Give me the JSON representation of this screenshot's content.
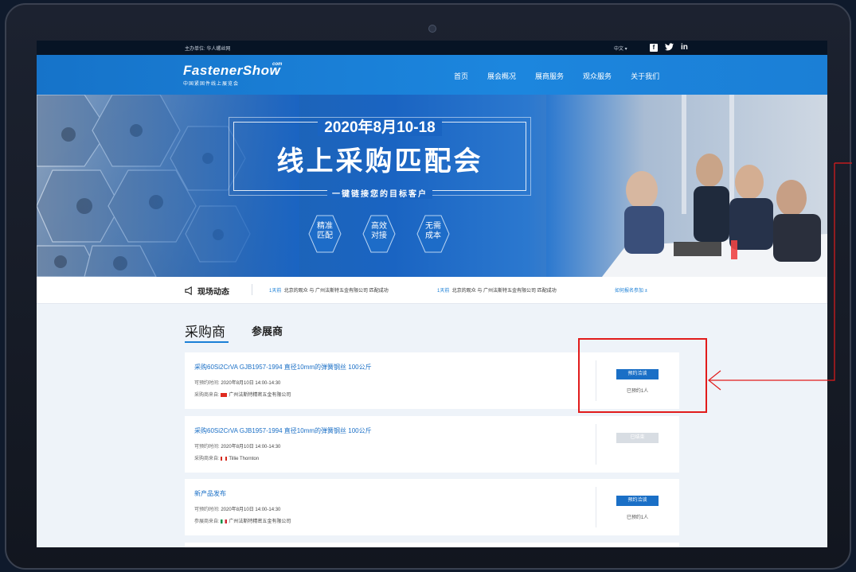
{
  "topbar": {
    "host": "主办单位: 华人螺丝网",
    "language": "中文 ▾",
    "social": {
      "facebook": "f",
      "twitter": "🐦",
      "linkedin": "in"
    }
  },
  "header": {
    "logo_main": "FastenerShow",
    "logo_com": "com",
    "logo_sub": "中国紧固件线上展览会",
    "nav": [
      "首页",
      "展会概况",
      "展商服务",
      "观众服务",
      "关于我们"
    ]
  },
  "hero": {
    "date": "2020年8月10-18",
    "title": "线上采购匹配会",
    "tagline": "一键链接您的目标客户",
    "features": [
      "精准\n匹配",
      "高效\n对接",
      "无需\n成本"
    ]
  },
  "ticker": {
    "title": "现场动态",
    "items": [
      {
        "time": "1天前",
        "text": "北京的观众 与 广州法斯特五金有限公司 匹配成功"
      },
      {
        "time": "1天前",
        "text": "北京的观众 与 广州法斯特五金有限公司 匹配成功"
      }
    ],
    "howto": "如何报名参加 ±"
  },
  "tabs": {
    "active": "采购商",
    "other": "参展商"
  },
  "cards": [
    {
      "title": "采购60Si2CrVA GJB1957-1994 直径10mm的弹簧钢丝 100公斤",
      "time_label": "可预约时间:",
      "time": "2020年8月10日 14:00-14:30",
      "from_label": "采购商来自:",
      "from": "广州法斯特精密五金有限公司",
      "flag": "cn",
      "button": "预约洽谈",
      "button_state": "active",
      "booked": "已预约1人"
    },
    {
      "title": "采购60Si2CrVA GJB1957-1994 直径10mm的弹簧钢丝 100公斤",
      "time_label": "可预约时间:",
      "time": "2020年8月10日 14:00-14:30",
      "from_label": "采购商来自:",
      "from": "Tillie Thornton",
      "flag": "ca",
      "button": "已结束",
      "button_state": "disabled",
      "booked": ""
    },
    {
      "title": "新产品发布",
      "time_label": "可预约时间:",
      "time": "2020年8月10日 14:00-14:30",
      "from_label": "参展商来自:",
      "from": "广州法斯特精密五金有限公司",
      "flag": "it",
      "button": "预约洽谈",
      "button_state": "active",
      "booked": "已预约1人"
    }
  ],
  "colors": {
    "accent": "#1a7fd6",
    "annotation": "#e11b1b"
  }
}
